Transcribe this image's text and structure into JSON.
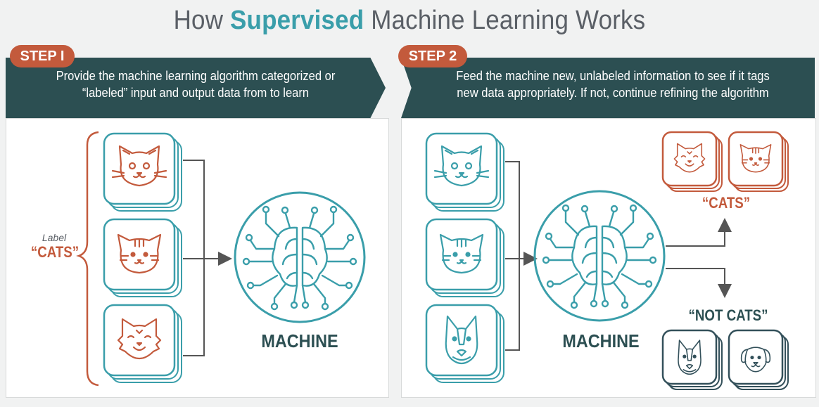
{
  "title": {
    "prefix": "How ",
    "highlight": "Supervised",
    "suffix": " Machine Learning Works"
  },
  "step1": {
    "badge": "STEP I",
    "line1": "Provide the machine learning algorithm categorized or",
    "line2": "“labeled” input and output data from to learn",
    "label_small": "Label",
    "label_big": "“CATS”",
    "machine": "MACHINE"
  },
  "step2": {
    "badge": "STEP 2",
    "line1": "Feed the machine new, unlabeled information to see if it tags",
    "line2": "new data appropriately. If not, continue refining the algorithm",
    "machine": "MACHINE",
    "cats_label": "“CATS”",
    "not_cats_label": "“NOT CATS”"
  },
  "colors": {
    "teal": "#3a9eaa",
    "orange": "#c35a3c",
    "dark_teal": "#2c4f52",
    "gray_text": "#5a5f66",
    "navy": "#33505a"
  },
  "icons": [
    "cat-face-icon",
    "striped-cat-icon",
    "fluffy-cat-icon",
    "brain-circuit-icon",
    "husky-dog-icon",
    "puppy-icon"
  ]
}
